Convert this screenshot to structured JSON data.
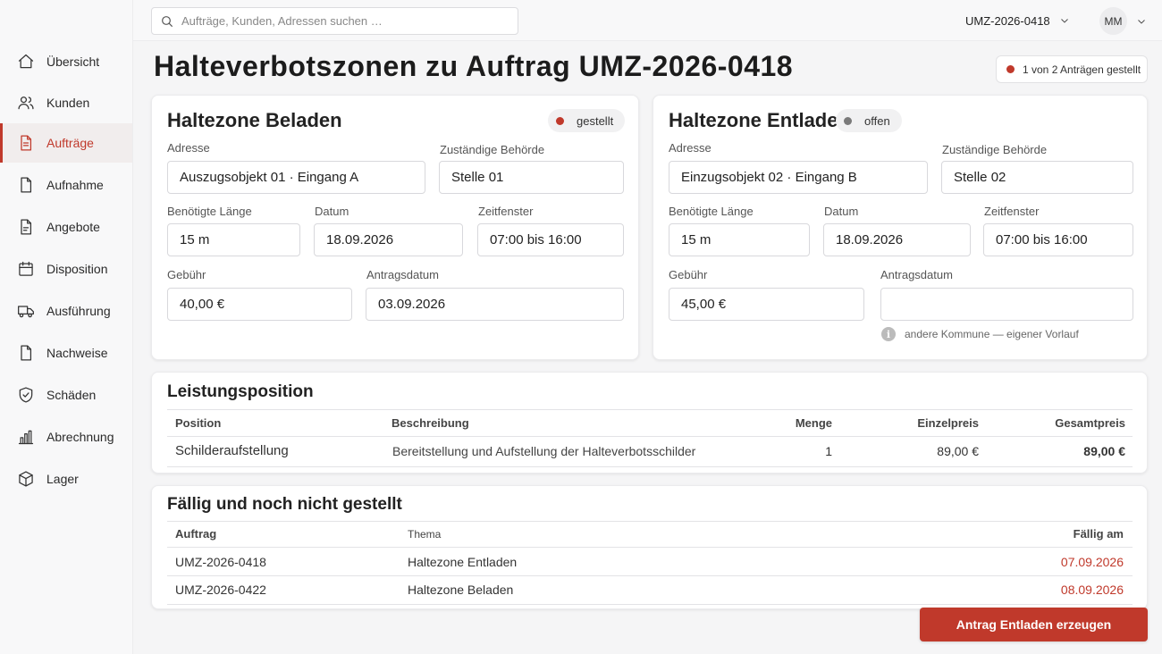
{
  "colors": {
    "accent": "#c0392b",
    "neutral_dot": "#7a7a7a"
  },
  "search": {
    "placeholder": "Aufträge, Kunden, Adressen suchen …"
  },
  "topbar": {
    "order": "UMZ-2026-0418",
    "user_initials": "MM"
  },
  "sidebar": {
    "items": [
      {
        "label": "Übersicht",
        "icon": "home-icon"
      },
      {
        "label": "Kunden",
        "icon": "users-icon"
      },
      {
        "label": "Aufträge",
        "icon": "document-icon",
        "active": true
      },
      {
        "label": "Aufnahme",
        "icon": "clipboard-icon"
      },
      {
        "label": "Angebote",
        "icon": "document-icon"
      },
      {
        "label": "Disposition",
        "icon": "calendar-icon"
      },
      {
        "label": "Ausführung",
        "icon": "truck-icon"
      },
      {
        "label": "Nachweise",
        "icon": "document-icon"
      },
      {
        "label": "Schäden",
        "icon": "shield-icon"
      },
      {
        "label": "Abrechnung",
        "icon": "bar-chart-icon"
      },
      {
        "label": "Lager",
        "icon": "box-icon"
      }
    ]
  },
  "page": {
    "title": "Halteverbotszonen zu Auftrag UMZ-2026-0418",
    "status": "1 von 2 Anträgen gestellt"
  },
  "loading_zone": {
    "title": "Haltezone Beladen",
    "badge": "gestellt",
    "address_label": "Adresse",
    "address": "Auszugsobjekt 01 · Eingang A",
    "authority_label": "Zuständige Behörde",
    "authority": "Stelle 01",
    "length_label": "Benötigte Länge",
    "length": "15 m",
    "date_label": "Datum",
    "date": "18.09.2026",
    "window_label": "Zeitfenster",
    "window": "07:00 bis 16:00",
    "fee_label": "Gebühr",
    "fee": "40,00 €",
    "request_date_label": "Antragsdatum",
    "request_date": "03.09.2026"
  },
  "unloading_zone": {
    "title": "Haltezone Entladen",
    "badge": "offen",
    "address_label": "Adresse",
    "address": "Einzugsobjekt 02 · Eingang B",
    "authority_label": "Zuständige Behörde",
    "authority": "Stelle 02",
    "length_label": "Benötigte Länge",
    "length": "15 m",
    "date_label": "Datum",
    "date": "18.09.2026",
    "window_label": "Zeitfenster",
    "window": "07:00 bis 16:00",
    "fee_label": "Gebühr",
    "fee": "45,00 €",
    "request_date_label": "Antragsdatum",
    "request_date": "",
    "note": "andere Kommune — eigener Vorlauf"
  },
  "service_item": {
    "title": "Leistungsposition",
    "headers": {
      "position": "Position",
      "description": "Beschreibung",
      "quantity": "Menge",
      "unit_price": "Einzelpreis",
      "total": "Gesamtpreis"
    },
    "row": {
      "position": "Schilderaufstellung",
      "description": "Bereitstellung und Aufstellung der Halteverbotsschilder",
      "quantity": "1",
      "unit_price": "89,00 €",
      "total": "89,00 €"
    }
  },
  "due": {
    "title": "Fällig und noch nicht gestellt",
    "headers": {
      "order": "Auftrag",
      "topic": "Thema",
      "due_date": "Fällig am"
    },
    "rows": [
      {
        "order": "UMZ-2026-0418",
        "topic": "Haltezone Entladen",
        "due_date": "07.09.2026"
      },
      {
        "order": "UMZ-2026-0422",
        "topic": "Haltezone Beladen",
        "due_date": "08.09.2026"
      }
    ]
  },
  "actions": {
    "create_request": "Antrag Entladen erzeugen"
  }
}
